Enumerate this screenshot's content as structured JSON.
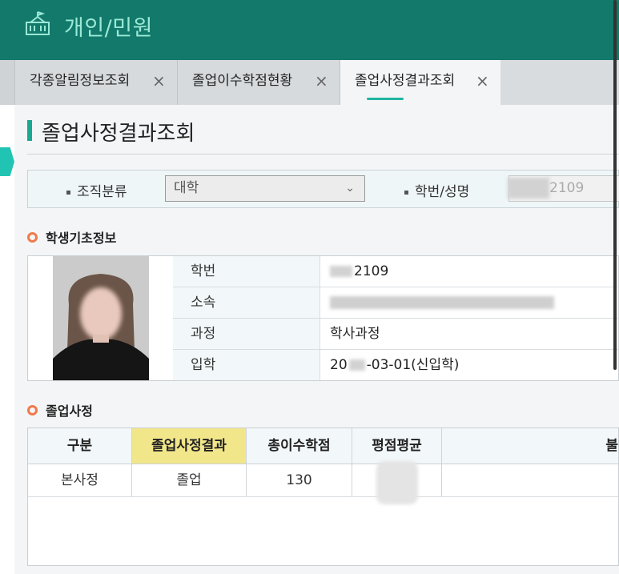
{
  "header": {
    "title": "개인/민원",
    "icon": "school-icon"
  },
  "tabs": [
    {
      "label": "각종알림정보조회",
      "close": "×"
    },
    {
      "label": "졸업이수학점현황",
      "close": "×"
    },
    {
      "label": "졸업사정결과조회",
      "close": "×",
      "active": true
    }
  ],
  "page": {
    "title": "졸업사정결과조회"
  },
  "filter": {
    "org_label": "조직분류",
    "org_value": "대학",
    "student_label": "학번/성명",
    "student_value": "2109"
  },
  "student_info": {
    "section_title": "학생기초정보",
    "rows": [
      {
        "key": "학번",
        "value": "2109"
      },
      {
        "key": "소속",
        "value": ""
      },
      {
        "key": "과정",
        "value": "학사과정"
      },
      {
        "key": "입학",
        "value": "20",
        "value2": "-03-01(신입학)"
      }
    ]
  },
  "graduation": {
    "section_title": "졸업사정",
    "columns": [
      "구분",
      "졸업사정결과",
      "총이수학점",
      "평점평균",
      "불"
    ],
    "rows": [
      [
        "본사정",
        "졸업",
        "130",
        "",
        ""
      ]
    ]
  },
  "colors": {
    "header_bg": "#12796b",
    "accent": "#1aa892",
    "highlight_col": "#f2e68b",
    "section_ring": "#f07a4a"
  }
}
